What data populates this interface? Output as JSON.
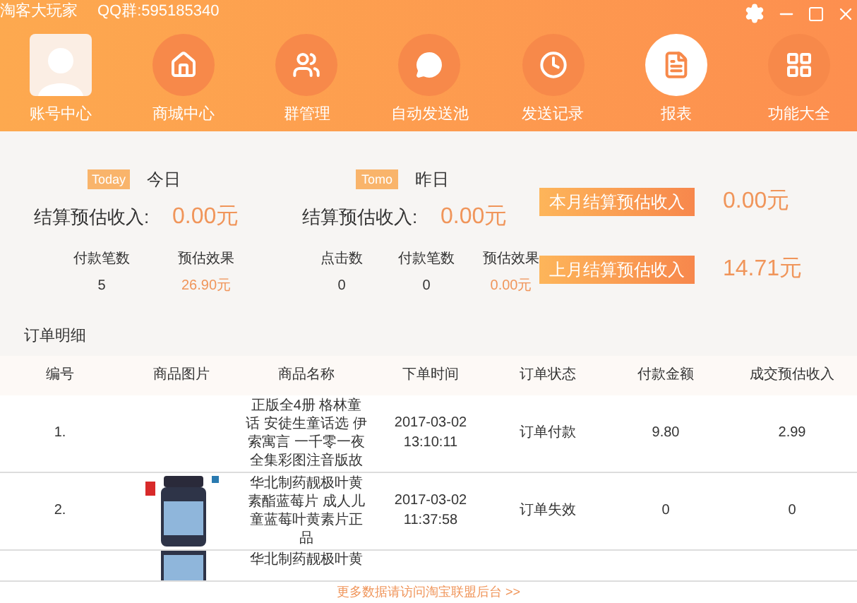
{
  "titlebar": {
    "user": "淘客大玩家",
    "qq": "QQ群:595185340"
  },
  "nav": [
    {
      "label": "账号中心",
      "kind": "avatar",
      "selected": false
    },
    {
      "label": "商城中心",
      "kind": "home",
      "selected": false
    },
    {
      "label": "群管理",
      "kind": "group",
      "selected": false
    },
    {
      "label": "自动发送池",
      "kind": "chat",
      "selected": false
    },
    {
      "label": "发送记录",
      "kind": "clock",
      "selected": false
    },
    {
      "label": "报表",
      "kind": "report",
      "selected": true
    },
    {
      "label": "功能大全",
      "kind": "grid",
      "selected": false
    }
  ],
  "summary": {
    "days": [
      {
        "badge": "Today",
        "title": "今日",
        "income_label": "结算预估收入:",
        "income": "0.00元",
        "stats": [
          {
            "label": "付款笔数",
            "value": "5",
            "kind": "plain"
          },
          {
            "label": "预估效果",
            "value": "26.90元",
            "kind": "money"
          }
        ]
      },
      {
        "badge": "Tomo",
        "title": "昨日",
        "income_label": "结算预估收入:",
        "income": "0.00元",
        "stats": [
          {
            "label": "点击数",
            "value": "0",
            "kind": "plain"
          },
          {
            "label": "付款笔数",
            "value": "0",
            "kind": "plain"
          },
          {
            "label": "预估效果",
            "value": "0.00元",
            "kind": "money"
          }
        ]
      }
    ],
    "months": [
      {
        "label": "本月结算预估收入",
        "value": "0.00元"
      },
      {
        "label": "上月结算预估收入",
        "value": "14.71元"
      }
    ]
  },
  "orders": {
    "title": "订单明细",
    "columns": [
      "编号",
      "商品图片",
      "商品名称",
      "下单时间",
      "订单状态",
      "付款金额",
      "成交预估收入"
    ],
    "rows": [
      {
        "number": "1.",
        "has_image": false,
        "name": "正版全4册 格林童话 安徒生童话选 伊索寓言 一千零一夜全集彩图注音版故",
        "date": "2017-03-02",
        "time": "13:10:11",
        "status": "订单付款",
        "amount": "9.80",
        "income": "2.99"
      },
      {
        "number": "2.",
        "has_image": true,
        "name": "华北制药靓极叶黄素酯蓝莓片 成人儿童蓝莓叶黄素片正品",
        "date": "2017-03-02",
        "time": "11:37:58",
        "status": "订单失效",
        "amount": "0",
        "income": "0"
      },
      {
        "has_image": true,
        "name": "华北制药靓极叶黄"
      }
    ]
  },
  "footer_link": "更多数据请访问淘宝联盟后台 >>"
}
